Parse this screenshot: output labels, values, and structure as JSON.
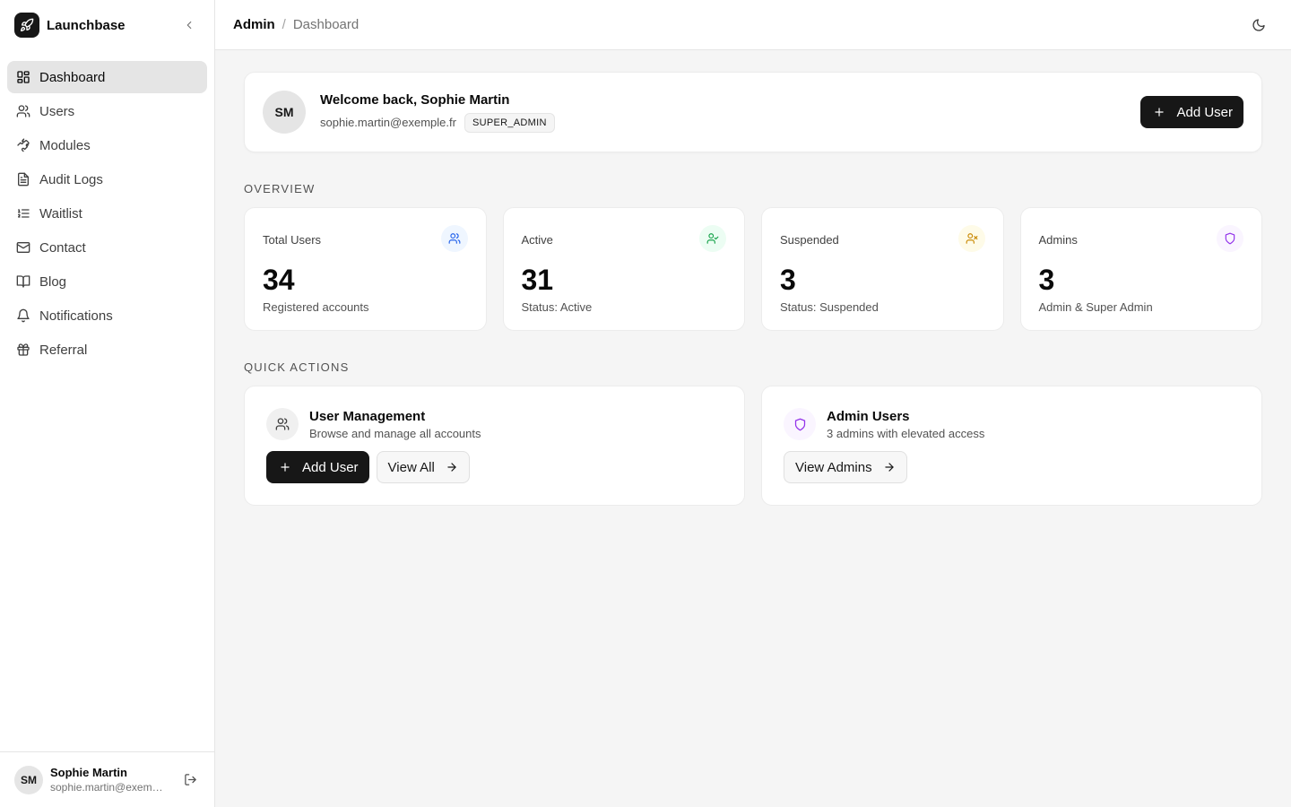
{
  "app": {
    "name": "Launchbase"
  },
  "sidebar": {
    "items": [
      {
        "label": "Dashboard",
        "icon": "dashboard-icon",
        "active": true
      },
      {
        "label": "Users",
        "icon": "users-icon"
      },
      {
        "label": "Modules",
        "icon": "puzzle-icon"
      },
      {
        "label": "Audit Logs",
        "icon": "file-text-icon"
      },
      {
        "label": "Waitlist",
        "icon": "list-ordered-icon"
      },
      {
        "label": "Contact",
        "icon": "mail-icon"
      },
      {
        "label": "Blog",
        "icon": "book-open-icon"
      },
      {
        "label": "Notifications",
        "icon": "bell-icon"
      },
      {
        "label": "Referral",
        "icon": "gift-icon"
      }
    ],
    "user": {
      "initials": "SM",
      "name": "Sophie Martin",
      "email": "sophie.martin@exemple.fr"
    }
  },
  "header": {
    "breadcrumb_root": "Admin",
    "breadcrumb_separator": "/",
    "breadcrumb_current": "Dashboard"
  },
  "welcome": {
    "initials": "SM",
    "title": "Welcome back, Sophie Martin",
    "email": "sophie.martin@exemple.fr",
    "role": "SUPER_ADMIN",
    "add_user_label": "Add User"
  },
  "overview": {
    "heading": "OVERVIEW",
    "cards": [
      {
        "label": "Total Users",
        "value": "34",
        "caption": "Registered accounts",
        "icon": "users-icon",
        "color": "#2563eb",
        "bg": "#eff6ff"
      },
      {
        "label": "Active",
        "value": "31",
        "caption": "Status: Active",
        "icon": "user-check-icon",
        "color": "#16a34a",
        "bg": "#ecfdf3"
      },
      {
        "label": "Suspended",
        "value": "3",
        "caption": "Status: Suspended",
        "icon": "user-x-icon",
        "color": "#ca8a04",
        "bg": "#fefbe8"
      },
      {
        "label": "Admins",
        "value": "3",
        "caption": "Admin & Super Admin",
        "icon": "shield-icon",
        "color": "#9333ea",
        "bg": "#faf5ff"
      }
    ]
  },
  "quick_actions": {
    "heading": "QUICK ACTIONS",
    "user_management": {
      "title": "User Management",
      "description": "Browse and manage all accounts",
      "add_label": "Add User",
      "view_label": "View All"
    },
    "admin_users": {
      "title": "Admin Users",
      "description": "3 admins with elevated access",
      "view_label": "View Admins"
    }
  },
  "colors": {
    "primary": "#171717",
    "background": "#f5f5f5",
    "accent_purple": "#9333ea"
  }
}
